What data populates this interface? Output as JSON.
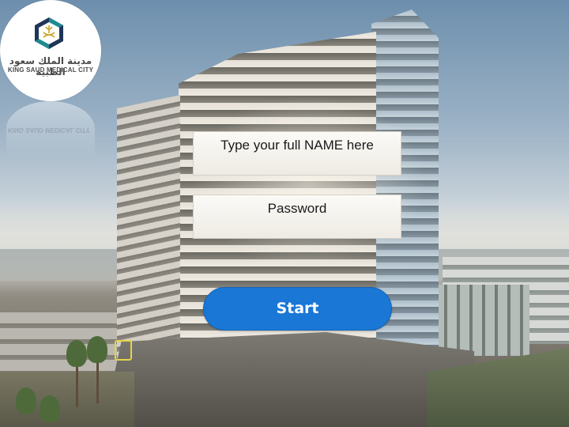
{
  "logo": {
    "arabic_name": "مدينة الملك سعود الطبية",
    "english_name": "KING SAUD MEDICAL CITY",
    "reflection_text": "KING SAUD MEDICAL CITY",
    "colors": {
      "hex_teal": "#1f8a92",
      "hex_navy": "#1f3558",
      "emblem_gold": "#c9a227"
    }
  },
  "form": {
    "name_placeholder": "Type your full NAME here",
    "password_placeholder": "Password",
    "start_label": "Start"
  },
  "colors": {
    "button": "#1a77d6",
    "button_text": "#ffffff",
    "field_bg": "#f5f3ee"
  }
}
